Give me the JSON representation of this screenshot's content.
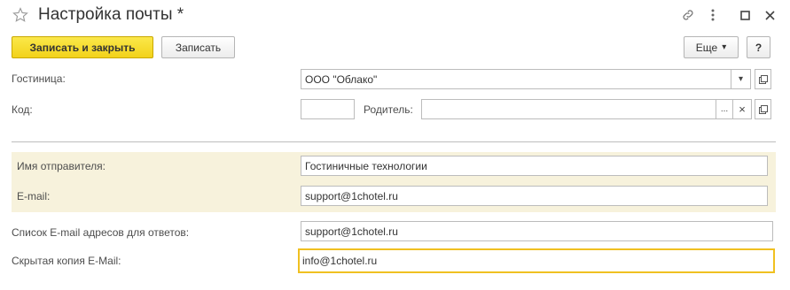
{
  "window": {
    "title": "Настройка почты *"
  },
  "toolbar": {
    "save_close_label": "Записать и закрыть",
    "save_label": "Записать",
    "more_label": "Еще",
    "more_arrow": "▾",
    "help_label": "?"
  },
  "form": {
    "hotel": {
      "label": "Гостиница:",
      "value": "ООО \"Облако\""
    },
    "code": {
      "label": "Код:",
      "value": ""
    },
    "parent": {
      "label": "Родитель:",
      "value": ""
    },
    "sender_name": {
      "label": "Имя отправителя:",
      "value": "Гостиничные технологии"
    },
    "email": {
      "label": "E-mail:",
      "value": "support@1chotel.ru"
    },
    "reply_list": {
      "label": "Список E-mail адресов для ответов:",
      "value": "support@1chotel.ru"
    },
    "bcc": {
      "label": "Скрытая копия E-Mail:",
      "value": "info@1chotel.ru"
    }
  },
  "glyphs": {
    "dropdown": "▾",
    "ellipsis": "...",
    "clear": "×"
  },
  "colors": {
    "primary_button": "#f5d92a",
    "highlight_bg": "#f7f2dc",
    "focus_border": "#f0c020"
  }
}
